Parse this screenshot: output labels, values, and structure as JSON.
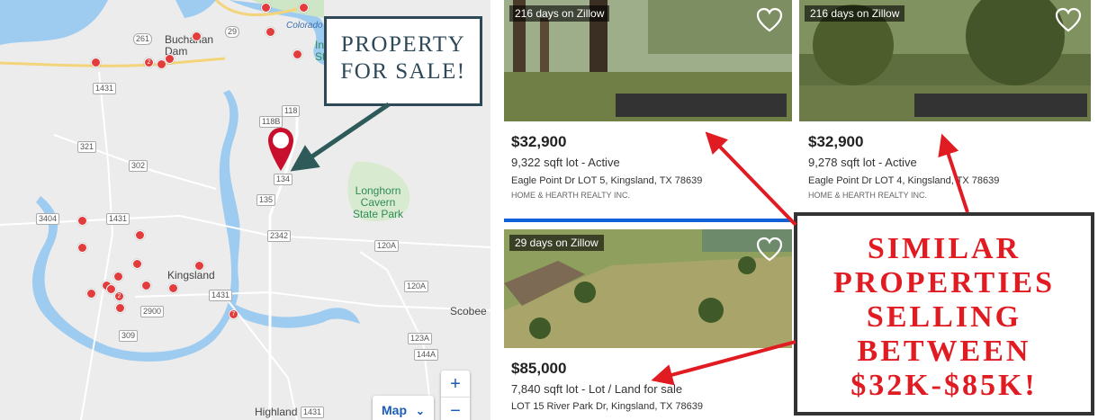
{
  "map": {
    "highways": [
      "261",
      "29",
      "1431",
      "321",
      "302",
      "118",
      "118B",
      "134",
      "135",
      "3404",
      "1431",
      "2342",
      "120A",
      "1431",
      "120A",
      "2900",
      "309",
      "123A",
      "144A",
      "1431"
    ],
    "labels": {
      "buchanan_dam": "Buchanan\nDam",
      "colorado": "Colorado",
      "longhorn": "Longhorn\nCavern\nState Park",
      "kingsland": "Kingsland",
      "scobee": "Scobee",
      "highland": "Highland",
      "inks": "In\nSt"
    },
    "dot_numbers": [
      "2",
      "2",
      "7"
    ],
    "zoom_in": "+",
    "zoom_out": "−",
    "map_type": "Map",
    "map_type_icon": "chevron-down-icon"
  },
  "callout_property": "PROPERTY\nFOR SALE!",
  "listings": [
    {
      "days": "216 days on Zillow",
      "price": "$32,900",
      "facts": "9,322 sqft lot  - Active",
      "address": "Eagle Point Dr LOT 5, Kingsland, TX 78639",
      "broker": "HOME & HEARTH REALTY INC."
    },
    {
      "days": "216 days on Zillow",
      "price": "$32,900",
      "facts": "9,278 sqft lot  - Active",
      "address": "Eagle Point Dr LOT 4, Kingsland, TX 78639",
      "broker": "HOME & HEARTH REALTY INC."
    },
    {
      "days": "29 days on Zillow",
      "price": "$85,000",
      "facts": "7,840 sqft lot  - Lot / Land for sale",
      "address": "LOT 15 River Park Dr, Kingsland, TX 78639",
      "broker": ""
    }
  ],
  "callout_similar": "SIMILAR\nPROPERTIES\nSELLING\nBETWEEN\n$32K-$85K!",
  "colors": {
    "accent_red": "#e11b22",
    "callout_green": "#2f4858",
    "marker_red": "#e23c3c",
    "zillow_blue": "#1160d8"
  }
}
